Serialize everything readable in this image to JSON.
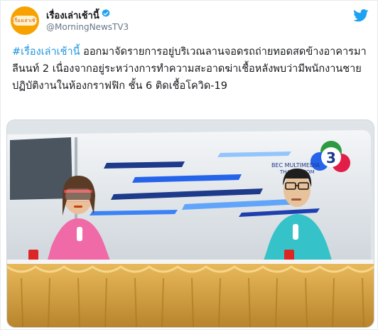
{
  "tweet": {
    "display_name": "เรื่องเล่าเช้านี้",
    "handle": "@MorningNewsTV3",
    "avatar_logo_text": "เรื่องเล่าเช้านี้",
    "hashtag": "#เรื่องเล่าเช้านี้",
    "body": " ออกมาจัดรายการอยู่บริเวณลานจอดรถถ่ายทอดสดข้างอาคารมาลีนนท์ 2 เนื่องจากอยู่ระหว่างการทำความสะอาดฆ่าเชื้อหลังพบว่ามีพนักงานชาย ปฏิบัติงานในห้องกราฟฟิก ชั้น 6 ติดเชื้อโควิด-19"
  },
  "media": {
    "van_logo_text": "BEC MULTIMEDIA",
    "van_logo_url": "THAITV3.COM",
    "channel_number": "3"
  },
  "colors": {
    "link": "#1b95e0",
    "twitter_blue": "#1da1f2",
    "handle_grey": "#657786",
    "pink_shirt": "#f06aa8",
    "teal_shirt": "#35c3c9",
    "gold_cloth": "#d9a441"
  },
  "icons": [
    "verified-badge-icon",
    "twitter-bird-icon"
  ]
}
